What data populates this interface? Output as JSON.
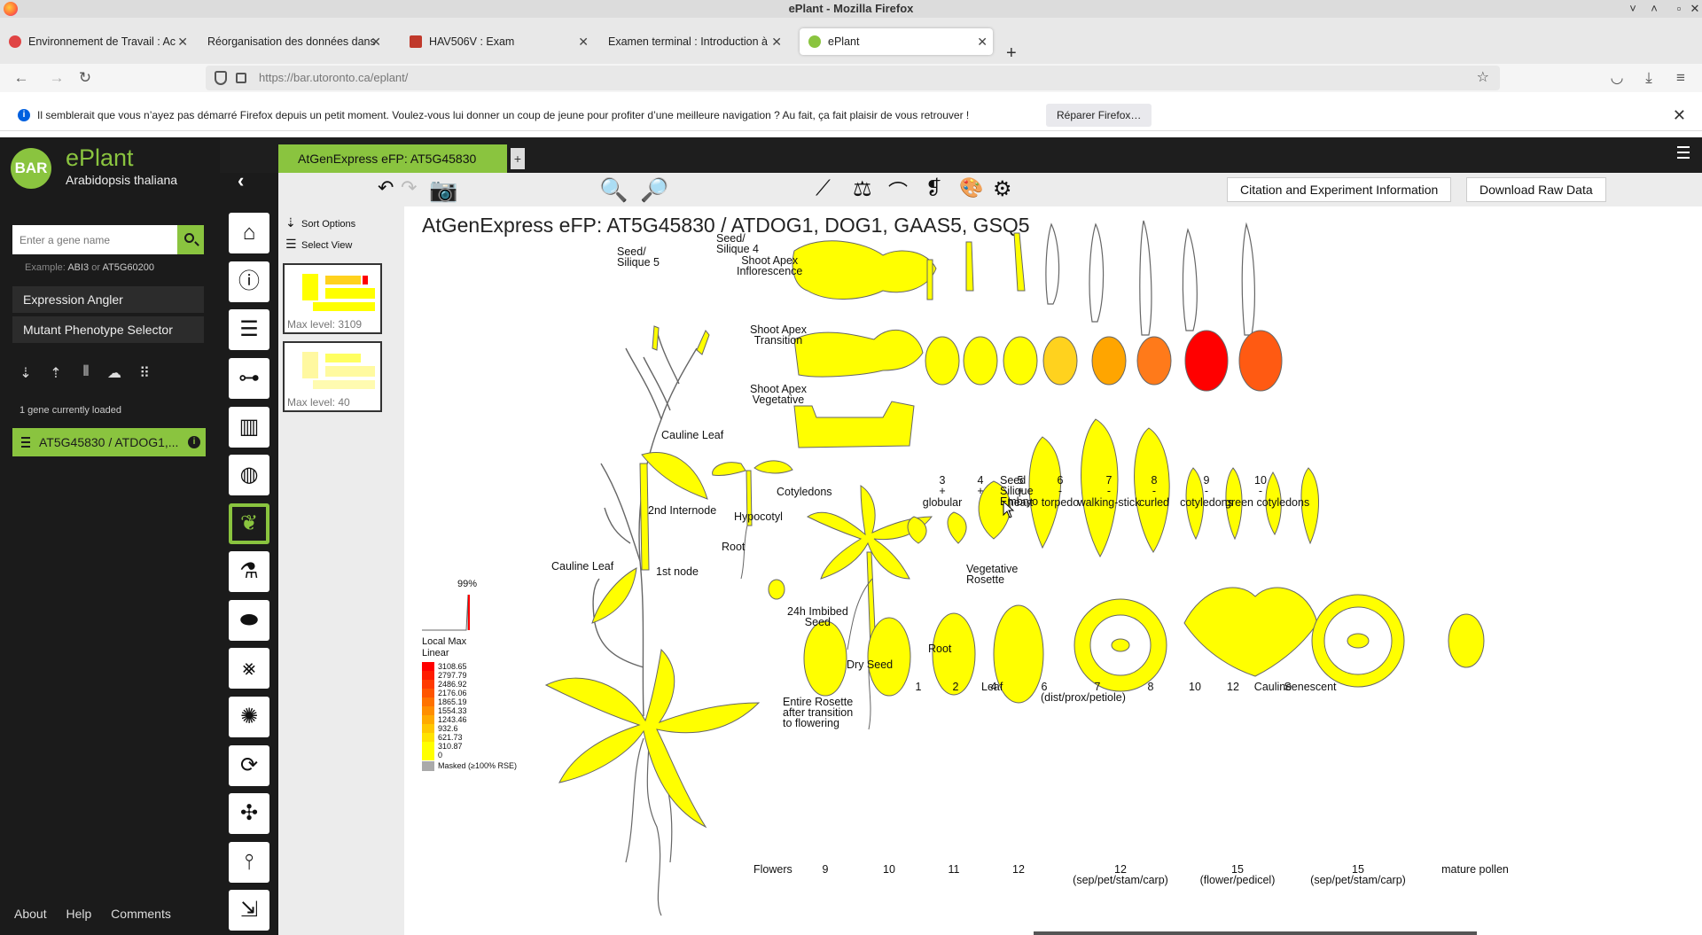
{
  "browser": {
    "window_title": "ePlant - Mozilla Firefox",
    "tabs": [
      {
        "label": "Environnement de Travail : Ac",
        "icon_color": "#e04444"
      },
      {
        "label": "Réorganisation des données dans",
        "icon_color": ""
      },
      {
        "label": "HAV506V : Exam",
        "icon_color": "#c0392b"
      },
      {
        "label": "Examen terminal : Introduction à",
        "icon_color": ""
      },
      {
        "label": "ePlant",
        "icon_color": "#8ac43f",
        "active": true
      }
    ],
    "url": "https://bar.utoronto.ca/eplant/",
    "notification": {
      "text": "Il semblerait que vous n’ayez pas démarré Firefox depuis un petit moment. Voulez-vous lui donner un coup de jeune pour profiter d’une meilleure navigation ? Au fait, ça fait plaisir de vous retrouver !",
      "button": "Réparer Firefox…"
    }
  },
  "sidebar": {
    "logo": "BAR",
    "title": "ePlant",
    "subtitle": "Arabidopsis thaliana",
    "search_placeholder": "Enter a gene name",
    "example_prefix": "Example:",
    "example_1": "ABI3",
    "example_or": "or",
    "example_2": "AT5G60200",
    "buttons": [
      "Expression Angler",
      "Mutant Phenotype Selector"
    ],
    "loaded_count": "1 gene currently loaded",
    "gene_chip": "AT5G45830 / ATDOG1,...",
    "footer": [
      "About",
      "Help",
      "Comments"
    ]
  },
  "view_tab": {
    "label": "AtGenExpress eFP: AT5G45830",
    "add": "+"
  },
  "toolbar": {
    "citation_button": "Citation and Experiment Information",
    "download_button": "Download Raw Data"
  },
  "sort_panel": {
    "sort_options": "Sort Options",
    "select_view": "Select View",
    "thumb_1_caption": "Max level: 3109",
    "thumb_2_caption": "Max level: 40"
  },
  "efp": {
    "title": "AtGenExpress eFP: AT5G45830 / ATDOG1, DOG1, GAAS5, GSQ5",
    "labels": {
      "seed_silique_4": "Seed/\nSilique 4",
      "seed_silique_5": "Seed/\nSilique 5",
      "shoot_apex_inflorescence": "Shoot Apex\nInflorescence",
      "shoot_apex_transition": "Shoot Apex\nTransition",
      "shoot_apex_vegetative": "Shoot Apex\nVegetative",
      "cauline_leaf_top": "Cauline Leaf",
      "cauline_leaf_bottom": "Cauline Leaf",
      "internode": "2nd Internode",
      "first_node": "1st node",
      "cotyledons": "Cotyledons",
      "hypocotyl": "Hypocotyl",
      "root_seedling": "Root",
      "imbibed_seed": "24h Imbibed\nSeed",
      "dry_seed": "Dry Seed",
      "vegetative_rosette": "Vegetative\nRosette",
      "root_rosette": "Root",
      "entire_rosette": "Entire Rosette\nafter transition\nto flowering",
      "seed_silique_embryo": "Seed\nSilique\nEmbryo",
      "leaf": "Leaf",
      "flowers": "Flowers"
    },
    "seed_series": [
      {
        "n": "3",
        "s": "+",
        "e": "globular",
        "color": "#ffff00"
      },
      {
        "n": "4",
        "s": "+",
        "e": "",
        "color": "#ffff00"
      },
      {
        "n": "5",
        "s": "+",
        "e": "heart",
        "color": "#ffff00"
      },
      {
        "n": "6",
        "s": "-",
        "e": "torpedo",
        "color": "#ffd21e"
      },
      {
        "n": "7",
        "s": "-",
        "e": "walking-stick",
        "color": "#ffa500"
      },
      {
        "n": "8",
        "s": "-",
        "e": "curled",
        "color": "#ff7a1a"
      },
      {
        "n": "9",
        "s": "-",
        "e": "cotyledons",
        "color": "#ff0000"
      },
      {
        "n": "10",
        "s": "-",
        "e": "green cotyledons",
        "color": "#ff5a12"
      }
    ],
    "leaf_series": [
      "1",
      "2",
      "4",
      "6",
      "7",
      "8",
      "10",
      "12",
      "Cauline",
      "Senescent"
    ],
    "leaf_7_sub": "(dist/prox/petiole)",
    "flower_series": [
      "9",
      "10",
      "11",
      "12"
    ],
    "flower_extra": [
      {
        "n": "12",
        "sub": "(sep/pet/stam/carp)"
      },
      {
        "n": "15",
        "sub": "(flower/pedicel)"
      },
      {
        "n": "15",
        "sub": "(sep/pet/stam/carp)"
      },
      {
        "n": "mature pollen",
        "sub": ""
      }
    ],
    "legend": {
      "percent": "99%",
      "title": "Local Max",
      "scale": "Linear",
      "values": [
        "3108.65",
        "2797.79",
        "2486.92",
        "2176.06",
        "1865.19",
        "1554.33",
        "1243.46",
        "932.6",
        "621.73",
        "310.87",
        "0"
      ],
      "colors": [
        "#ff0000",
        "#ff1c00",
        "#ff3a00",
        "#ff5500",
        "#ff7200",
        "#ff8e00",
        "#ffaa00",
        "#ffc700",
        "#ffe300",
        "#ffff00",
        "#ffff00"
      ],
      "masked": "Masked (≥100% RSE)",
      "masked_color": "#aaaaaa"
    }
  }
}
